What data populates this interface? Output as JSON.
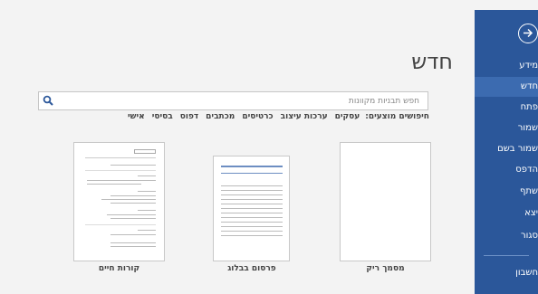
{
  "sidebar": {
    "back_icon": "back-arrow-icon",
    "items": [
      {
        "label": "מידע"
      },
      {
        "label": "חדש"
      },
      {
        "label": "פתח"
      },
      {
        "label": "שמור"
      },
      {
        "label": "שמור בשם"
      },
      {
        "label": "הדפס"
      },
      {
        "label": "שתף"
      },
      {
        "label": "יצא"
      },
      {
        "label": "סגור"
      },
      {
        "label": "חשבון"
      }
    ],
    "active_item": "חדש",
    "color": "#2b579a",
    "active_color": "#3c6bb0"
  },
  "main": {
    "title": "חדש",
    "search": {
      "placeholder": "חפש תבניות מקוונות",
      "icon": "search-icon"
    },
    "suggested": {
      "label": "חיפושים מוצעים:",
      "items": [
        "עסקים",
        "ערכות עיצוב",
        "כרטיסים",
        "מכתבים",
        "דפוס",
        "בסיסי",
        "אישי"
      ]
    },
    "templates": [
      {
        "label": "מסמך ריק"
      },
      {
        "label": "פרסום בבלוג"
      },
      {
        "label": "קורות חיים"
      }
    ]
  }
}
